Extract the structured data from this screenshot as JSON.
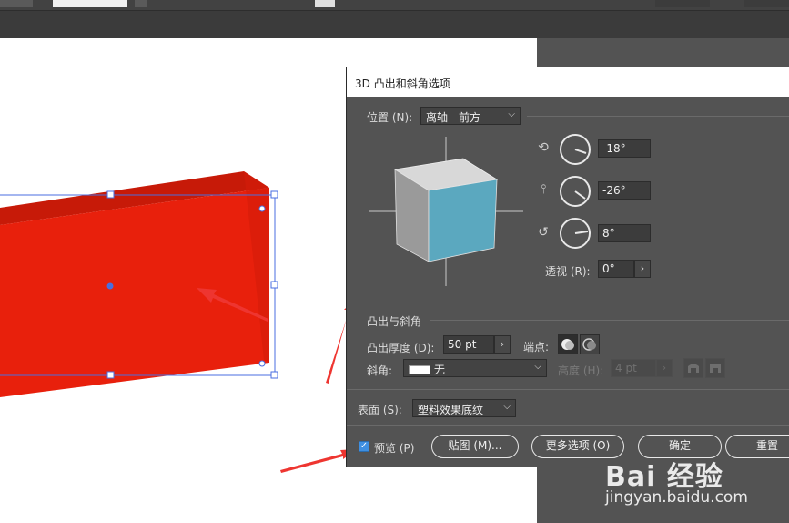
{
  "dialog": {
    "title": "3D 凸出和斜角选项",
    "position_label": "位置 (N):",
    "position_value": "离轴 - 前方",
    "rotation_x": "-18°",
    "rotation_y": "-26°",
    "rotation_z": "8°",
    "perspective_label": "透视 (R):",
    "perspective_value": "0°",
    "extrude_section": "凸出与斜角",
    "extrude_depth_label": "凸出厚度 (D):",
    "extrude_depth_value": "50 pt",
    "cap_label": "端点:",
    "bevel_label": "斜角:",
    "bevel_value": "无",
    "height_label": "高度 (H):",
    "height_value": "4 pt",
    "surface_label": "表面 (S):",
    "surface_value": "塑料效果底纹",
    "preview_label": "预览 (P)",
    "preview_checked": true,
    "map_button": "贴图 (M)...",
    "more_options_button": "更多选项 (O)",
    "ok_button": "确定",
    "reset_button": "重置"
  },
  "colors": {
    "shape_front": "#e8200c",
    "shape_top": "#c71a08",
    "cube_front": "#5ba8bf",
    "cube_side": "#9a9a9a",
    "cube_top": "#d8d8d8",
    "selection": "#4a6ee0",
    "arrow": "#ee3530",
    "checkbox": "#3f8fe0"
  },
  "icons": {
    "rotate_x": "rotate-x-axis-icon",
    "rotate_y": "rotate-y-axis-icon",
    "rotate_z": "rotate-z-axis-icon",
    "cap_on": "cap-on-icon",
    "cap_off": "cap-off-icon",
    "bevel_in": "bevel-in-icon",
    "bevel_out": "bevel-out-icon"
  },
  "watermark": {
    "brand": "Bai 经验",
    "url": "jingyan.baidu.com"
  }
}
